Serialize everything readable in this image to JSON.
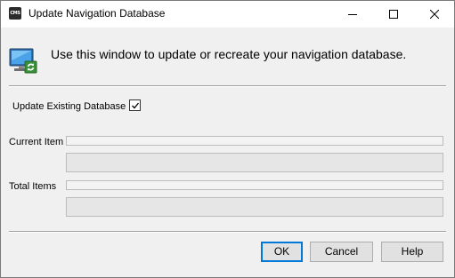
{
  "window": {
    "title": "Update Navigation Database",
    "app_icon_text": "CMS",
    "controls": [
      "minimize-icon",
      "maximize-icon",
      "close-icon"
    ]
  },
  "header": {
    "icon": "monitor-refresh-icon",
    "text": "Use this window to update or recreate your navigation database."
  },
  "options": {
    "update_existing_label": "Update Existing Database",
    "update_existing_checked": true
  },
  "progress": {
    "current_item_label": "Current Item",
    "current_item_text": "",
    "current_item_progress": 0,
    "total_items_label": "Total Items",
    "total_items_text": "",
    "total_items_progress": 0
  },
  "buttons": {
    "ok": "OK",
    "cancel": "Cancel",
    "help": "Help"
  },
  "colors": {
    "accent": "#0078d7",
    "dialog_bg": "#f0f0f0"
  }
}
